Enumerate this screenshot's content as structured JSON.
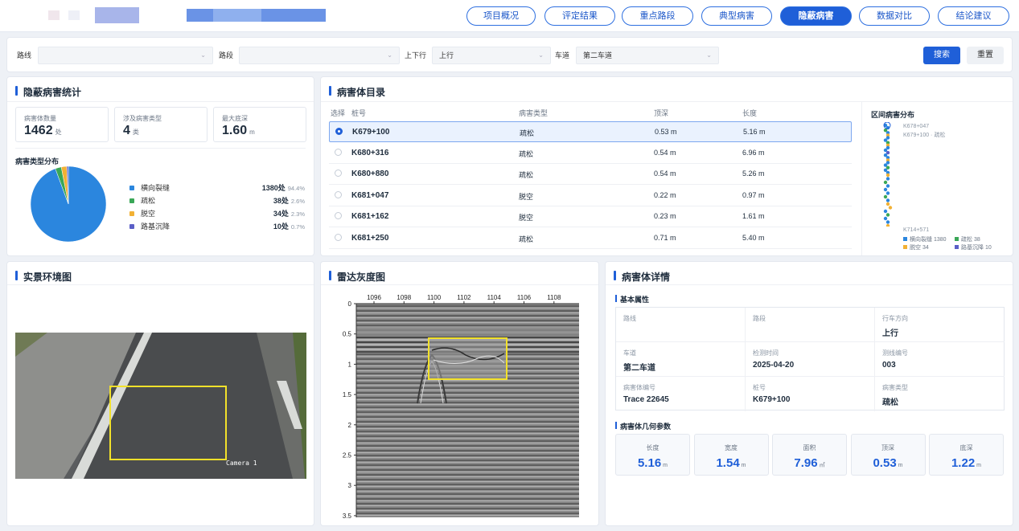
{
  "nav": [
    "项目概况",
    "评定结果",
    "重点路段",
    "典型病害",
    "隐蔽病害",
    "数据对比",
    "结论建议"
  ],
  "nav_active": 4,
  "filters": {
    "road_label": "路线",
    "segment_label": "路段",
    "direction_label": "上下行",
    "direction_value": "上行",
    "lane_label": "车道",
    "lane_value": "第二车道",
    "search": "搜索",
    "reset": "重置"
  },
  "stats": {
    "title": "隐蔽病害统计",
    "cards": [
      {
        "label": "病害体数量",
        "value": "1462",
        "unit": "处"
      },
      {
        "label": "涉及病害类型",
        "value": "4",
        "unit": "类"
      },
      {
        "label": "最大底深",
        "value": "1.60",
        "unit": "m"
      }
    ],
    "dist_title": "病害类型分布",
    "legend": [
      {
        "name": "横向裂缝",
        "count": "1380处",
        "pct": "94.4%",
        "color": "#2b86de"
      },
      {
        "name": "疏松",
        "count": "38处",
        "pct": "2.6%",
        "color": "#3aa757"
      },
      {
        "name": "脱空",
        "count": "34处",
        "pct": "2.3%",
        "color": "#f2b134"
      },
      {
        "name": "路基沉降",
        "count": "10处",
        "pct": "0.7%",
        "color": "#5b5fc7"
      }
    ]
  },
  "chart_data": {
    "type": "pie",
    "categories": [
      "横向裂缝",
      "疏松",
      "脱空",
      "路基沉降"
    ],
    "values": [
      1380,
      38,
      34,
      10
    ]
  },
  "catalog": {
    "title": "病害体目录",
    "headers": [
      "选择",
      "桩号",
      "病害类型",
      "顶深",
      "长度"
    ],
    "rows": [
      {
        "pile": "K679+100",
        "type": "疏松",
        "top": "0.53 m",
        "len": "5.16 m",
        "selected": true
      },
      {
        "pile": "K680+316",
        "type": "疏松",
        "top": "0.54 m",
        "len": "6.96 m",
        "selected": false
      },
      {
        "pile": "K680+880",
        "type": "疏松",
        "top": "0.54 m",
        "len": "5.26 m",
        "selected": false
      },
      {
        "pile": "K681+047",
        "type": "脱空",
        "top": "0.22 m",
        "len": "0.97 m",
        "selected": false
      },
      {
        "pile": "K681+162",
        "type": "脱空",
        "top": "0.23 m",
        "len": "1.61 m",
        "selected": false
      },
      {
        "pile": "K681+250",
        "type": "疏松",
        "top": "0.71 m",
        "len": "5.40 m",
        "selected": false
      }
    ],
    "dist": {
      "title": "区间病害分布",
      "start": "K678+047",
      "current": "K679+100 · 疏松",
      "end": "K714+571",
      "legend": [
        "横向裂缝 1380",
        "疏松 38",
        "脱空 34",
        "路基沉降 10"
      ]
    }
  },
  "scene": {
    "title": "实景环境图",
    "camera": "Camera 1"
  },
  "radar": {
    "title": "雷达灰度图",
    "x_ticks": [
      "1096",
      "1098",
      "1100",
      "1102",
      "1104",
      "1106",
      "1108"
    ],
    "y_ticks": [
      "0",
      "0.5",
      "1",
      "1.5",
      "2",
      "2.5",
      "3",
      "3.5"
    ]
  },
  "detail": {
    "title": "病害体详情",
    "basic_title": "基本属性",
    "cells": [
      {
        "k": "路线",
        "v": ""
      },
      {
        "k": "路段",
        "v": ""
      },
      {
        "k": "行车方向",
        "v": "上行"
      },
      {
        "k": "车道",
        "v": "第二车道"
      },
      {
        "k": "检测时间",
        "v": "2025-04-20"
      },
      {
        "k": "测线编号",
        "v": "003"
      },
      {
        "k": "病害体编号",
        "v": "Trace 22645"
      },
      {
        "k": "桩号",
        "v": "K679+100"
      },
      {
        "k": "病害类型",
        "v": "疏松"
      }
    ],
    "geo_title": "病害体几何参数",
    "geo": [
      {
        "k": "长度",
        "v": "5.16",
        "u": "m"
      },
      {
        "k": "宽度",
        "v": "1.54",
        "u": "m"
      },
      {
        "k": "面积",
        "v": "7.96",
        "u": "㎡"
      },
      {
        "k": "顶深",
        "v": "0.53",
        "u": "m"
      },
      {
        "k": "底深",
        "v": "1.22",
        "u": "m"
      }
    ]
  }
}
